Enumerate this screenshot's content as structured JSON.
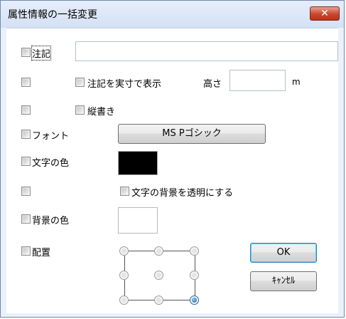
{
  "window": {
    "title": "属性情報の一括変更",
    "close_label": "✕"
  },
  "rows": {
    "note": {
      "label": "注記",
      "value": ""
    },
    "actual_size": {
      "label": "注記を実寸で表示",
      "height_label": "高さ",
      "height_value": "",
      "unit": "m"
    },
    "vertical": {
      "label": "縦書き"
    },
    "font": {
      "label": "フォント",
      "button_label": "MS Pゴシック"
    },
    "text_color": {
      "label": "文字の色",
      "color": "#000000"
    },
    "transparent_bg": {
      "label": "文字の背景を透明にする"
    },
    "bg_color": {
      "label": "背景の色",
      "color": "#ffffff"
    },
    "placement": {
      "label": "配置",
      "selected": "bottom-right"
    }
  },
  "buttons": {
    "ok_label": "OK",
    "cancel_label": "ｷｬﾝｾﾙ"
  }
}
